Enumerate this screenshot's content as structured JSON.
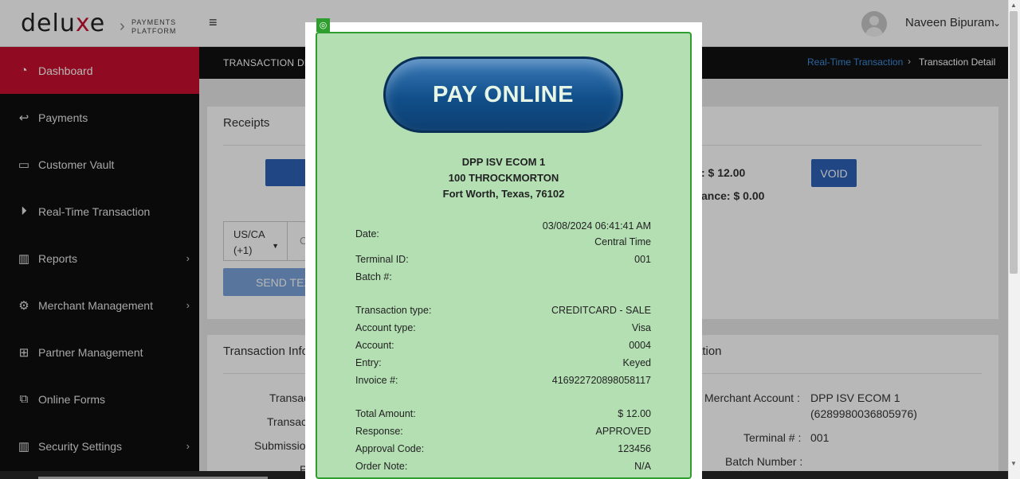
{
  "header": {
    "logo_main": "delu",
    "logo_x": "x",
    "logo_end": "e",
    "logo_sep": "›",
    "logo_sub1": "PAYMENTS",
    "logo_sub2": "PLATFORM",
    "menu_icon": "≡",
    "user_name": "Naveen Bipuram",
    "user_chevron": "⌄"
  },
  "sidebar": {
    "items": [
      {
        "label": "Dashboard",
        "icon": "◔"
      },
      {
        "label": "Payments",
        "icon": "↩"
      },
      {
        "label": "Customer Vault",
        "icon": "▭"
      },
      {
        "label": "Real-Time Transaction",
        "icon": "⏵"
      },
      {
        "label": "Reports",
        "icon": "▥",
        "chevron": "›"
      },
      {
        "label": "Merchant Management",
        "icon": "⚙",
        "chevron": "›"
      },
      {
        "label": "Partner Management",
        "icon": "⊞"
      },
      {
        "label": "Online Forms",
        "icon": "⧉"
      },
      {
        "label": "Security Settings",
        "icon": "▥",
        "chevron": "›"
      }
    ]
  },
  "subheader": {
    "title": "TRANSACTION DETAIL",
    "crumb_link": "Real-Time Transaction",
    "crumb_sep": "›",
    "crumb_current": "Transaction Detail"
  },
  "receipts_card": {
    "title": "Receipts",
    "amount_text": ": $ 12.00",
    "balance_text": "ance: $ 0.00",
    "void_label": "VOID",
    "country_value": "US/CA",
    "country_code": "(+1)",
    "phone_partial": "C",
    "send_text_label": "SEND TEXT"
  },
  "info_card": {
    "title": "Transaction Info",
    "right_title": "ation",
    "left_labels": [
      "Transac",
      "Transac",
      "Submissio",
      "P"
    ],
    "merchant_account_label": "Merchant Account :",
    "merchant_account_value": "DPP ISV ECOM 1",
    "merchant_account_id": "(6289980036805976)",
    "terminal_label": "Terminal # :",
    "terminal_value": "001",
    "batch_label": "Batch Number :"
  },
  "receipt": {
    "icon": "◎",
    "pay_online": "PAY ONLINE",
    "merchant_name": "DPP ISV ECOM 1",
    "address1": "100 THROCKMORTON",
    "address2": "Fort Worth, Texas, 76102",
    "rows1": [
      {
        "label": "Date:",
        "value": "03/08/2024 06:41:41 AM",
        "value2": "Central Time"
      },
      {
        "label": "Terminal ID:",
        "value": "001"
      },
      {
        "label": "Batch #:",
        "value": ""
      }
    ],
    "rows2": [
      {
        "label": "Transaction type:",
        "value": "CREDITCARD - SALE"
      },
      {
        "label": "Account type:",
        "value": "Visa"
      },
      {
        "label": "Account:",
        "value": "0004"
      },
      {
        "label": "Entry:",
        "value": "Keyed"
      },
      {
        "label": "Invoice #:",
        "value": "416922720898058117"
      }
    ],
    "rows3": [
      {
        "label": "Total Amount:",
        "value": "$ 12.00"
      },
      {
        "label": "Response:",
        "value": "APPROVED"
      },
      {
        "label": "Approval Code:",
        "value": "123456"
      },
      {
        "label": "Order Note:",
        "value": "N/A"
      }
    ]
  },
  "colors": {
    "brand_red": "#c8102e",
    "sidebar_bg": "#0f0f0f",
    "receipt_bg": "#b3dfb3",
    "pay_button": "#114f8a"
  }
}
